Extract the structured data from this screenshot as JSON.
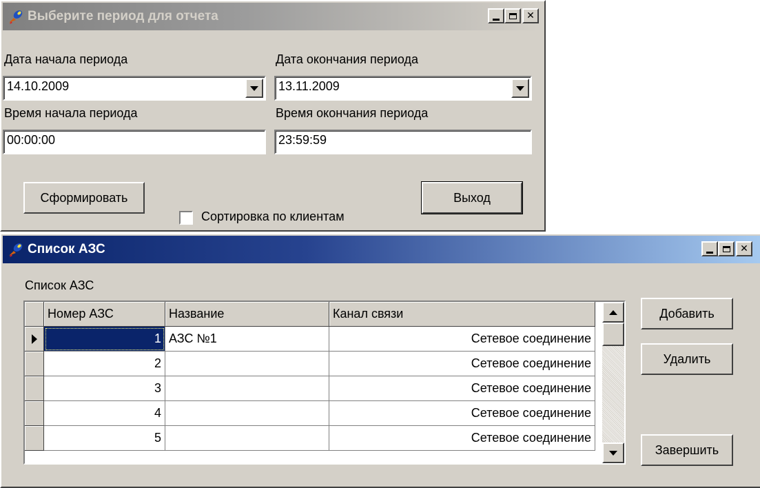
{
  "period_dialog": {
    "title": "Выберите период для отчета",
    "start_date_label": "Дата начала периода",
    "start_date_value": "14.10.2009",
    "end_date_label": "Дата окончания периода",
    "end_date_value": "13.11.2009",
    "start_time_label": "Время начала периода",
    "start_time_value": "00:00:00",
    "end_time_label": "Время окончания периода",
    "end_time_value": "23:59:59",
    "generate_button": "Сформировать",
    "sort_checkbox_label": "Сортировка по клиентам",
    "sort_checked": false,
    "exit_button": "Выход"
  },
  "azs_window": {
    "title": "Список АЗС",
    "list_label": "Список АЗС",
    "columns": [
      "Номер АЗС",
      "Название",
      "Канал связи"
    ],
    "rows": [
      {
        "number": "1",
        "name": "АЗС №1",
        "channel": "Сетевое соединение"
      },
      {
        "number": "2",
        "name": "",
        "channel": "Сетевое соединение"
      },
      {
        "number": "3",
        "name": "",
        "channel": "Сетевое соединение"
      },
      {
        "number": "4",
        "name": "",
        "channel": "Сетевое соединение"
      },
      {
        "number": "5",
        "name": "",
        "channel": "Сетевое соединение"
      }
    ],
    "add_button": "Добавить",
    "delete_button": "Удалить",
    "finish_button": "Завершить"
  },
  "colors": {
    "active_title": "#0a246a",
    "inactive_title": "#808080",
    "face": "#d4d0c8",
    "selection": "#0a246a"
  }
}
